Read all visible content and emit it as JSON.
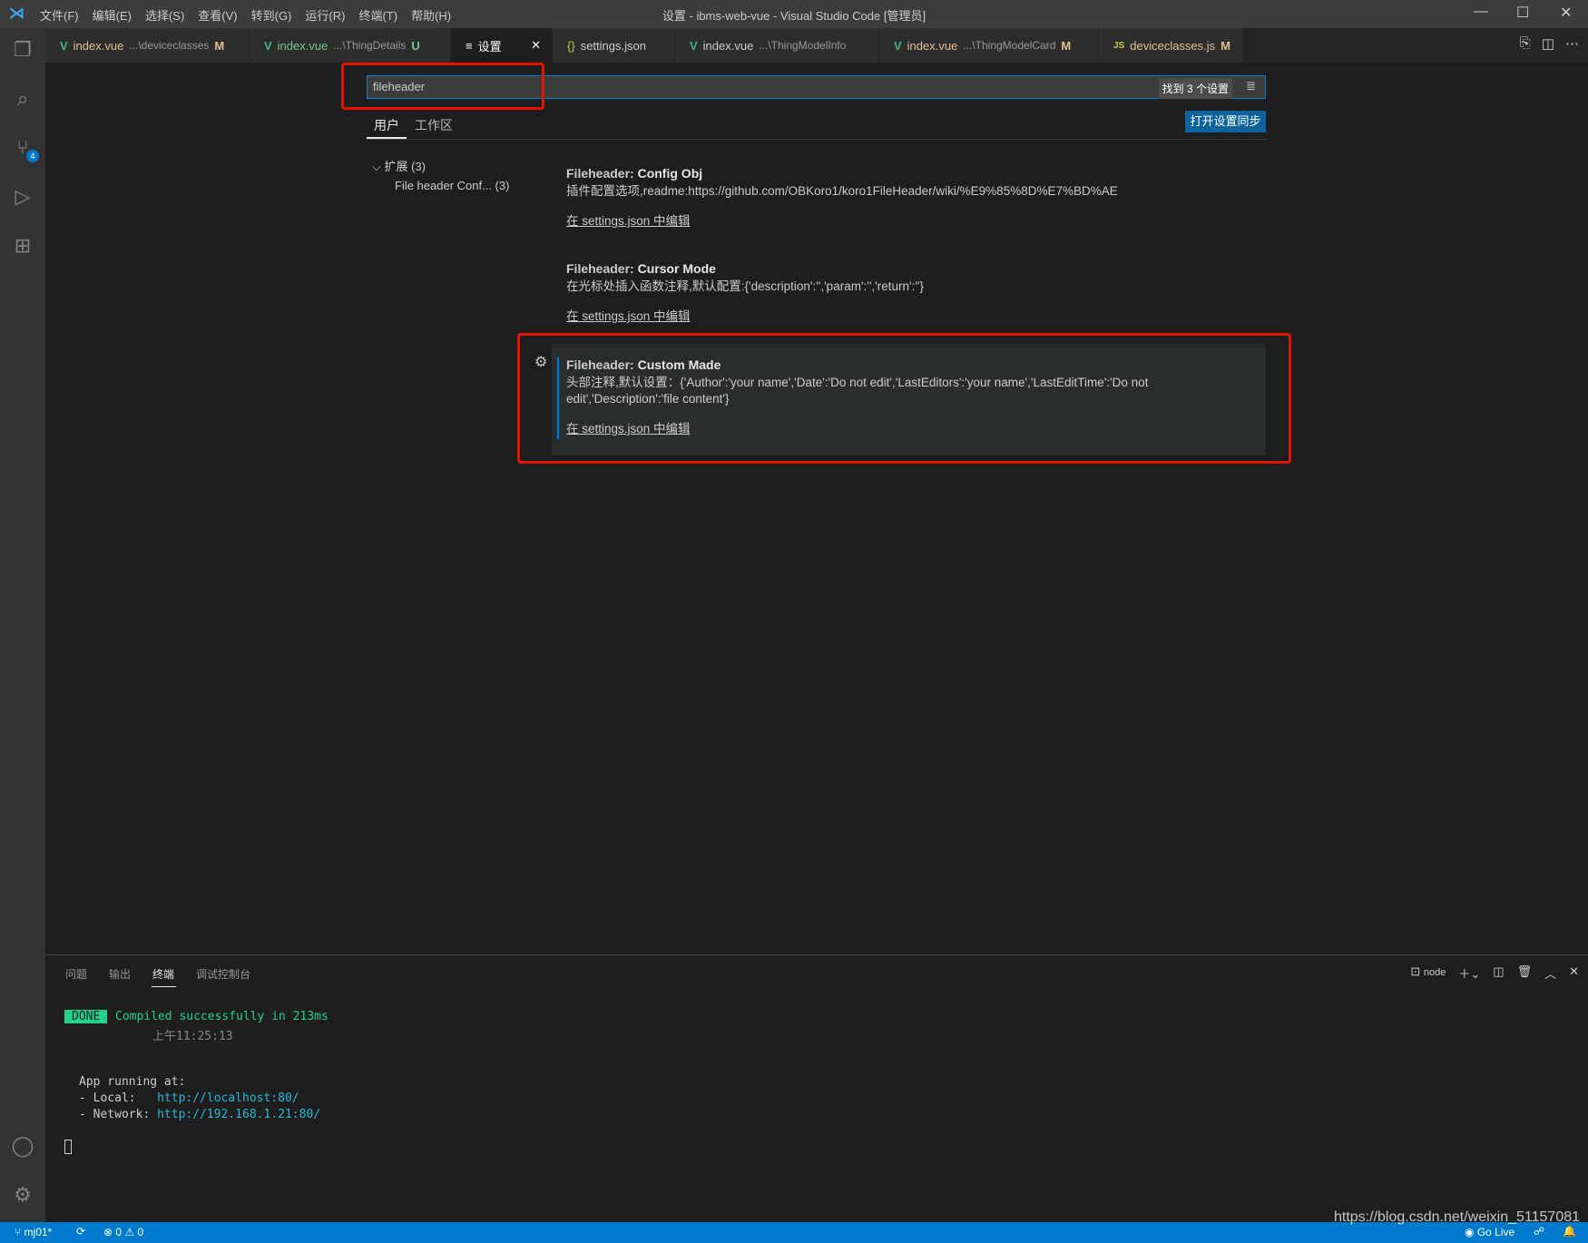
{
  "window": {
    "title": "设置 - ibms-web-vue - Visual Studio Code [管理员]",
    "menu": [
      "文件(F)",
      "编辑(E)",
      "选择(S)",
      "查看(V)",
      "转到(G)",
      "运行(R)",
      "终端(T)",
      "帮助(H)"
    ]
  },
  "activity": {
    "scm_badge": "4"
  },
  "tabs": [
    {
      "label": "index.vue",
      "path": "...\\deviceclasses",
      "status": "M",
      "icon": "vue-icon"
    },
    {
      "label": "index.vue",
      "path": "...\\ThingDetails",
      "status": "U",
      "icon": "vue-icon"
    },
    {
      "label": "设置",
      "icon": "settings-icon",
      "active": true
    },
    {
      "label": "settings.json",
      "icon": "json-icon"
    },
    {
      "label": "index.vue",
      "path": "...\\ThingModelInfo",
      "icon": "vue-icon"
    },
    {
      "label": "index.vue",
      "path": "...\\ThingModelCard",
      "status": "M",
      "icon": "vue-icon"
    },
    {
      "label": "deviceclasses.js",
      "status": "M",
      "icon": "js-icon"
    }
  ],
  "settings": {
    "search_value": "fileheader",
    "result_count": "找到 3 个设置",
    "scope_tabs": [
      "用户",
      "工作区"
    ],
    "sync_button": "打开设置同步",
    "tree": {
      "group": "扩展 (3)",
      "item": "File header Conf... (3)"
    },
    "items": [
      {
        "category": "Fileheader: ",
        "name": "Config Obj",
        "description": "插件配置选项,readme:https://github.com/OBKoro1/koro1FileHeader/wiki/%E9%85%8D%E7%BD%AE",
        "link": "在 settings.json 中编辑"
      },
      {
        "category": "Fileheader: ",
        "name": "Cursor Mode",
        "description": "在光标处插入函数注释,默认配置:{'description':'','param':'','return':''}",
        "link": "在 settings.json 中编辑"
      },
      {
        "category": "Fileheader: ",
        "name": "Custom Made",
        "description": "头部注释,默认设置：{'Author':'your name','Date':'Do not edit','LastEditors':'your name','LastEditTime':'Do not edit','Description':'file content'}",
        "link": "在 settings.json 中编辑"
      }
    ]
  },
  "panel": {
    "tabs": [
      "问题",
      "输出",
      "终端",
      "调试控制台"
    ],
    "terminal_name": "node",
    "lines": {
      "done": "DONE",
      "compiled": "Compiled successfully in 213ms",
      "time": "上午11:25:13",
      "running": "App running at:",
      "local_label": "- Local:   ",
      "local_url": "http://localhost:80/",
      "network_label": "- Network: ",
      "network_url": "http://192.168.1.21:80/"
    }
  },
  "statusbar": {
    "branch": "mj01*",
    "errors": "0",
    "warnings": "0",
    "golive": "Go Live",
    "watermark": "https://blog.csdn.net/weixin_51157081"
  }
}
